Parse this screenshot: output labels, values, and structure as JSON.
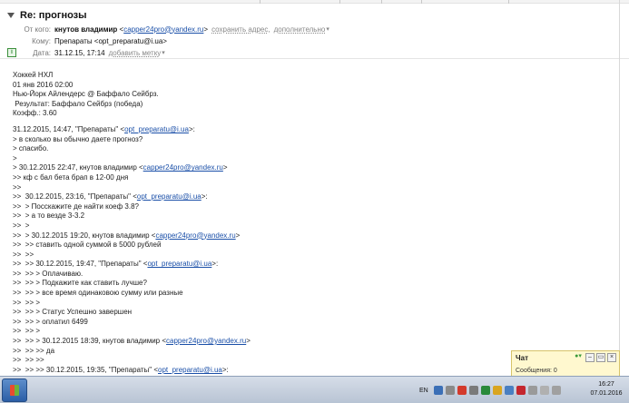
{
  "message": {
    "subject": "Re: прогнозы",
    "from_label": "От кого:",
    "from_name": "кнутов владимир",
    "from_email_prefix": "<",
    "from_email": "capper24pro@yandex.ru",
    "from_email_suffix": ">",
    "save_address_link": "сохранить адрес,",
    "more_link": "дополнительно",
    "to_label": "Кому:",
    "to_value": "Препараты <opt_preparatu@i.ua>",
    "date_label": "Дата:",
    "date_value": "31.12.15, 17:14",
    "add_label_link": "добавить метку"
  },
  "body": {
    "lines": [
      "Хоккей НХЛ",
      "01 янв 2016 02:00",
      "Нью-Йорк Айлендерс @ Баффало Сейбрз.",
      " Результат: Баффало Сейбрз (победа)",
      "Коэфф.: 3.60",
      "",
      "31.12.2015, 14:47, \"Препараты\" <",
      "> в сколько вы обычно даете прогноз?",
      "> спасибо.",
      ">",
      "> 30.12.2015 22:47, кнутов владимир <",
      ">> кф с бал бета брап в 12-00 дня",
      ">>",
      ">>  30.12.2015, 23:16, \"Препараты\" <",
      ">>  > Посскажите де найти коеф 3.8?",
      ">>  > а то везде 3-3.2",
      ">>  >",
      ">>  > 30.12.2015 19:20, кнутов владимир <",
      ">>  >> ставить одной суммой в 5000 рублей",
      ">>  >>",
      ">>  >> 30.12.2015, 19:47, \"Препараты\" <",
      ">>  >> > Оплачиваю.",
      ">>  >> > Подкажите как ставить лучше?",
      ">>  >> > все время одинаковою сумму или разные",
      ">>  >> >",
      ">>  >> > Статус Успешно завершен",
      ">>  >> > оплатил 6499",
      ">>  >> >",
      ">>  >> > 30.12.2015 18:39, кнутов владимир <",
      ">>  >> >> да",
      ">>  >> >>",
      ">>  >> >> 30.12.2015, 19:35, \"Препараты\" <"
    ],
    "mail_i_ua": "opt_preparatu@i.ua",
    "mail_yandex": "capper24pro@yandex.ru",
    "suffix_colon": ">:",
    "suffix_plain": ">"
  },
  "chat": {
    "title": "Чат",
    "messages_label": "Сообщения: 0"
  },
  "taskbar": {
    "language": "EN",
    "time": "16:27",
    "date": "07.01.2016"
  },
  "colors": {
    "link": "#1a4fa8",
    "chat_bg": "#fff8cf",
    "taskbar": "#c7d1de"
  }
}
